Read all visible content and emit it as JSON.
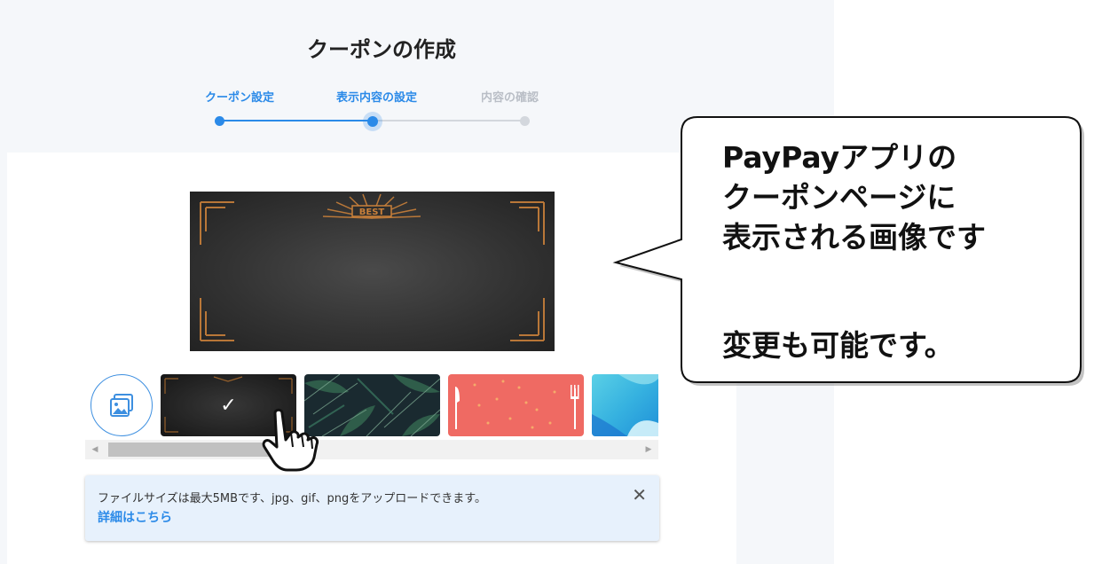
{
  "page": {
    "title": "クーポンの作成"
  },
  "steps": [
    {
      "label": "クーポン設定",
      "state": "done"
    },
    {
      "label": "表示内容の設定",
      "state": "current"
    },
    {
      "label": "内容の確認",
      "state": "pending"
    }
  ],
  "preview": {
    "badge_text": "BEST"
  },
  "gallery": {
    "upload_icon": "image-upload-icon",
    "selected_check": "✓",
    "thumbnails": [
      {
        "name": "chalkboard-frame",
        "selected": true
      },
      {
        "name": "tropical-leaves",
        "selected": false
      },
      {
        "name": "red-dots-cutlery",
        "selected": false
      },
      {
        "name": "blue-gradient",
        "selected": false
      }
    ]
  },
  "info": {
    "text": "ファイルサイズは最大5MBです、jpg、gif、pngをアップロードできます。",
    "link": "詳細はこちら",
    "close": "✕"
  },
  "callout": {
    "line1": "PayPayアプリの",
    "line2": "クーポンページに",
    "line3": "表示される画像です",
    "line4": "変更も可能です。"
  },
  "colors": {
    "accent": "#2b8ae8",
    "inactive": "#d3d7dd",
    "info_bg": "#e7f1fc"
  }
}
